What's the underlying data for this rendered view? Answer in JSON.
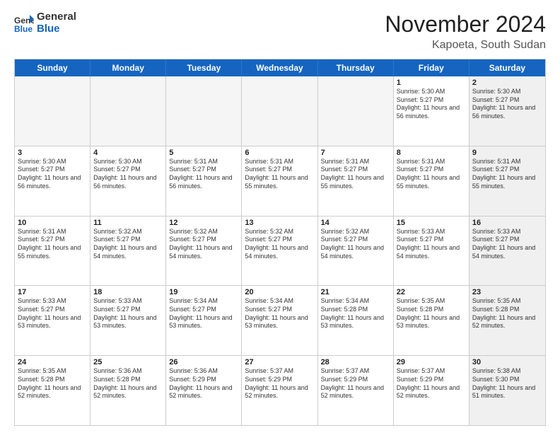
{
  "logo": {
    "general": "General",
    "blue": "Blue"
  },
  "title": {
    "month": "November 2024",
    "location": "Kapoeta, South Sudan"
  },
  "header": {
    "days": [
      "Sunday",
      "Monday",
      "Tuesday",
      "Wednesday",
      "Thursday",
      "Friday",
      "Saturday"
    ]
  },
  "weeks": [
    [
      {
        "day": "",
        "info": "",
        "empty": true
      },
      {
        "day": "",
        "info": "",
        "empty": true
      },
      {
        "day": "",
        "info": "",
        "empty": true
      },
      {
        "day": "",
        "info": "",
        "empty": true
      },
      {
        "day": "",
        "info": "",
        "empty": true
      },
      {
        "day": "1",
        "info": "Sunrise: 5:30 AM\nSunset: 5:27 PM\nDaylight: 11 hours\nand 56 minutes.",
        "empty": false,
        "shaded": false
      },
      {
        "day": "2",
        "info": "Sunrise: 5:30 AM\nSunset: 5:27 PM\nDaylight: 11 hours\nand 56 minutes.",
        "empty": false,
        "shaded": true
      }
    ],
    [
      {
        "day": "3",
        "info": "Sunrise: 5:30 AM\nSunset: 5:27 PM\nDaylight: 11 hours\nand 56 minutes.",
        "empty": false,
        "shaded": false
      },
      {
        "day": "4",
        "info": "Sunrise: 5:30 AM\nSunset: 5:27 PM\nDaylight: 11 hours\nand 56 minutes.",
        "empty": false,
        "shaded": false
      },
      {
        "day": "5",
        "info": "Sunrise: 5:31 AM\nSunset: 5:27 PM\nDaylight: 11 hours\nand 56 minutes.",
        "empty": false,
        "shaded": false
      },
      {
        "day": "6",
        "info": "Sunrise: 5:31 AM\nSunset: 5:27 PM\nDaylight: 11 hours\nand 55 minutes.",
        "empty": false,
        "shaded": false
      },
      {
        "day": "7",
        "info": "Sunrise: 5:31 AM\nSunset: 5:27 PM\nDaylight: 11 hours\nand 55 minutes.",
        "empty": false,
        "shaded": false
      },
      {
        "day": "8",
        "info": "Sunrise: 5:31 AM\nSunset: 5:27 PM\nDaylight: 11 hours\nand 55 minutes.",
        "empty": false,
        "shaded": false
      },
      {
        "day": "9",
        "info": "Sunrise: 5:31 AM\nSunset: 5:27 PM\nDaylight: 11 hours\nand 55 minutes.",
        "empty": false,
        "shaded": true
      }
    ],
    [
      {
        "day": "10",
        "info": "Sunrise: 5:31 AM\nSunset: 5:27 PM\nDaylight: 11 hours\nand 55 minutes.",
        "empty": false,
        "shaded": false
      },
      {
        "day": "11",
        "info": "Sunrise: 5:32 AM\nSunset: 5:27 PM\nDaylight: 11 hours\nand 54 minutes.",
        "empty": false,
        "shaded": false
      },
      {
        "day": "12",
        "info": "Sunrise: 5:32 AM\nSunset: 5:27 PM\nDaylight: 11 hours\nand 54 minutes.",
        "empty": false,
        "shaded": false
      },
      {
        "day": "13",
        "info": "Sunrise: 5:32 AM\nSunset: 5:27 PM\nDaylight: 11 hours\nand 54 minutes.",
        "empty": false,
        "shaded": false
      },
      {
        "day": "14",
        "info": "Sunrise: 5:32 AM\nSunset: 5:27 PM\nDaylight: 11 hours\nand 54 minutes.",
        "empty": false,
        "shaded": false
      },
      {
        "day": "15",
        "info": "Sunrise: 5:33 AM\nSunset: 5:27 PM\nDaylight: 11 hours\nand 54 minutes.",
        "empty": false,
        "shaded": false
      },
      {
        "day": "16",
        "info": "Sunrise: 5:33 AM\nSunset: 5:27 PM\nDaylight: 11 hours\nand 54 minutes.",
        "empty": false,
        "shaded": true
      }
    ],
    [
      {
        "day": "17",
        "info": "Sunrise: 5:33 AM\nSunset: 5:27 PM\nDaylight: 11 hours\nand 53 minutes.",
        "empty": false,
        "shaded": false
      },
      {
        "day": "18",
        "info": "Sunrise: 5:33 AM\nSunset: 5:27 PM\nDaylight: 11 hours\nand 53 minutes.",
        "empty": false,
        "shaded": false
      },
      {
        "day": "19",
        "info": "Sunrise: 5:34 AM\nSunset: 5:27 PM\nDaylight: 11 hours\nand 53 minutes.",
        "empty": false,
        "shaded": false
      },
      {
        "day": "20",
        "info": "Sunrise: 5:34 AM\nSunset: 5:27 PM\nDaylight: 11 hours\nand 53 minutes.",
        "empty": false,
        "shaded": false
      },
      {
        "day": "21",
        "info": "Sunrise: 5:34 AM\nSunset: 5:28 PM\nDaylight: 11 hours\nand 53 minutes.",
        "empty": false,
        "shaded": false
      },
      {
        "day": "22",
        "info": "Sunrise: 5:35 AM\nSunset: 5:28 PM\nDaylight: 11 hours\nand 53 minutes.",
        "empty": false,
        "shaded": false
      },
      {
        "day": "23",
        "info": "Sunrise: 5:35 AM\nSunset: 5:28 PM\nDaylight: 11 hours\nand 52 minutes.",
        "empty": false,
        "shaded": true
      }
    ],
    [
      {
        "day": "24",
        "info": "Sunrise: 5:35 AM\nSunset: 5:28 PM\nDaylight: 11 hours\nand 52 minutes.",
        "empty": false,
        "shaded": false
      },
      {
        "day": "25",
        "info": "Sunrise: 5:36 AM\nSunset: 5:28 PM\nDaylight: 11 hours\nand 52 minutes.",
        "empty": false,
        "shaded": false
      },
      {
        "day": "26",
        "info": "Sunrise: 5:36 AM\nSunset: 5:29 PM\nDaylight: 11 hours\nand 52 minutes.",
        "empty": false,
        "shaded": false
      },
      {
        "day": "27",
        "info": "Sunrise: 5:37 AM\nSunset: 5:29 PM\nDaylight: 11 hours\nand 52 minutes.",
        "empty": false,
        "shaded": false
      },
      {
        "day": "28",
        "info": "Sunrise: 5:37 AM\nSunset: 5:29 PM\nDaylight: 11 hours\nand 52 minutes.",
        "empty": false,
        "shaded": false
      },
      {
        "day": "29",
        "info": "Sunrise: 5:37 AM\nSunset: 5:29 PM\nDaylight: 11 hours\nand 52 minutes.",
        "empty": false,
        "shaded": false
      },
      {
        "day": "30",
        "info": "Sunrise: 5:38 AM\nSunset: 5:30 PM\nDaylight: 11 hours\nand 51 minutes.",
        "empty": false,
        "shaded": true
      }
    ]
  ]
}
